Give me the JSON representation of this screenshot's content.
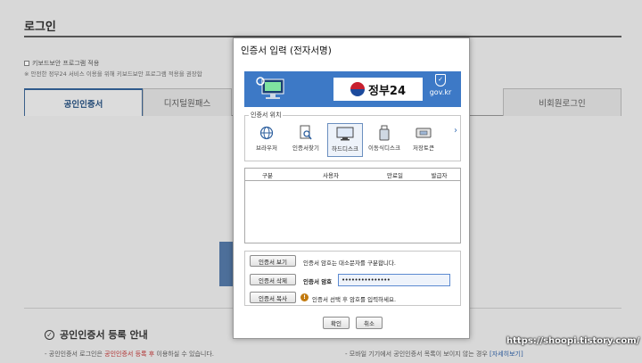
{
  "background": {
    "page_title": "로그인",
    "keyboard_security_label": "키보드보안 프로그램 적용",
    "security_note": "※ 안전한 정부24 서비스 이용을 위해 키보드보안 프로그램 적용을 권장합",
    "tabs": [
      {
        "label": "공인인증서",
        "active": true
      },
      {
        "label": "디지털원패스",
        "active": false
      },
      {
        "label": "비회원로그인",
        "active": false
      }
    ],
    "register_title": "공인인증서 등록 안내",
    "bottom_left_prefix": "-  공인인증서 로그인은 ",
    "bottom_left_red": "공인인증서 등록 후",
    "bottom_left_suffix": " 이용하실 수 있습니다.",
    "bottom_right_prefix": "-  모바일 기기에서 공인인증서 목록이 보이지 않는 경우 ",
    "bottom_right_link": "[자세히보기]"
  },
  "watermark": "https://shoopi.tistory.com/",
  "dialog": {
    "title": "인증서 입력 (전자서명)",
    "banner": {
      "logo_text": "정부24",
      "domain_text": "gov.kr"
    },
    "location": {
      "legend": "인증서 위치",
      "items": [
        {
          "label": "브라우저",
          "icon": "globe-icon"
        },
        {
          "label": "인증서찾기",
          "icon": "cert-search-icon"
        },
        {
          "label": "하드디스크",
          "icon": "monitor-icon",
          "selected": true
        },
        {
          "label": "이동식디스크",
          "icon": "usb-icon"
        },
        {
          "label": "저장토큰",
          "icon": "token-icon"
        }
      ]
    },
    "table": {
      "columns": [
        "구분",
        "사용자",
        "만료일",
        "발급자"
      ]
    },
    "ops": {
      "view_button": "인증서 보기",
      "delete_button": "인증서 삭제",
      "copy_button": "인증서 복사",
      "case_note": "인증서 암호는 대소문자를 구분합니다.",
      "password_label": "인증서 암호",
      "password_value": "•••••••••••••••",
      "hint": "인증서 선택 후 암호를 입력하세요."
    },
    "ok_button": "확인",
    "cancel_button": "취소"
  },
  "colors": {
    "banner_blue": "#3d79c6",
    "active_tab": "#2f5a8c",
    "warning": "#c27a0e"
  }
}
